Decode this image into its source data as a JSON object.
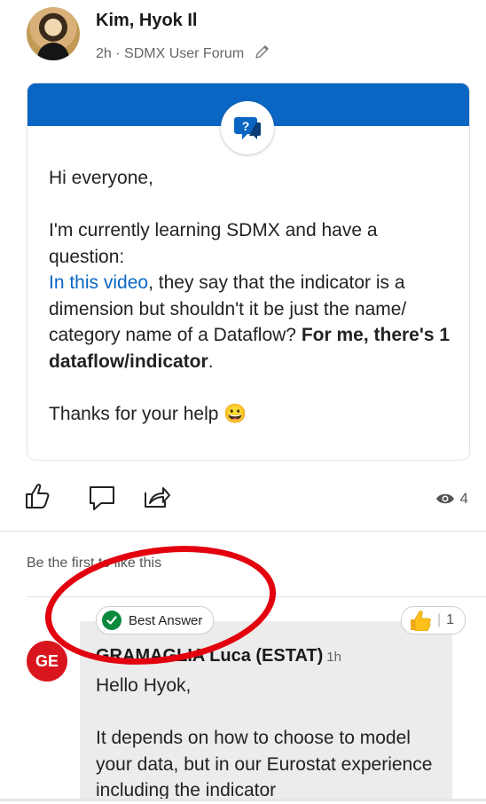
{
  "post": {
    "author": "Kim, Hyok Il",
    "meta": "2h · SDMX User Forum",
    "greeting": "Hi everyone,",
    "line1": "I'm currently learning SDMX and have a question:",
    "link_text": "In this video",
    "line2": ", they say that the indicator is a dimension but shouldn't it be just the name/ category name of a Dataflow? ",
    "bold_text": "For me, there's 1 dataflow/indicator",
    "line2_end": ".",
    "thanks": "Thanks for your help 😀",
    "views": "4",
    "likes_text": "Be the first to like this"
  },
  "comment": {
    "badge": "Best Answer",
    "reaction_count": "1",
    "avatar_initials": "GE",
    "author": "GRAMAGLIA Luca (ESTAT)",
    "time": "1h",
    "greeting": "Hello Hyok,",
    "body": "It depends on how to choose to model your data, but in our Eurostat experience including the indicator"
  },
  "colors": {
    "accent": "#0a66c2",
    "badge_green": "#0b8a3e",
    "avatar_red": "#d9161e",
    "annotation_red": "#e3000f"
  }
}
